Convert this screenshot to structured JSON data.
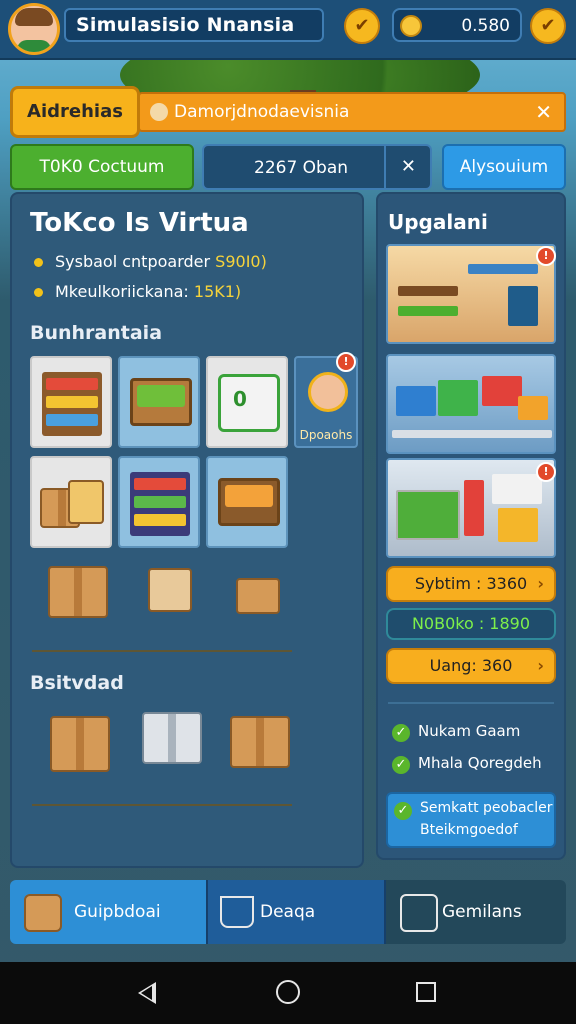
{
  "header": {
    "title": "Simulasisio Nnansia",
    "coin_value": "0.580",
    "left_coin_icon": "checkmark-coin-icon",
    "right_coin_icon": "checkmark-coin-icon"
  },
  "banner": {
    "tag": "Aidrehias",
    "message": "Damorjdnodaevisnia",
    "close": "✕"
  },
  "actions": {
    "green_button": "T0K0 Coctuum",
    "field_value": "2267 Oban",
    "field_clear": "✕",
    "blue_button": "Alysouium"
  },
  "store": {
    "title": "ToKco Is Virtua",
    "stats": [
      {
        "label": "Sysbaol cntpoarder ",
        "value": "S90I0)"
      },
      {
        "label": "Mkeulkoriickana: ",
        "value": "15K1)"
      }
    ],
    "section1": "Bunhrantaia",
    "worker_label": "Dpoaohs",
    "worker_badge": "!",
    "section2": "Bsitvdad"
  },
  "upgrades": {
    "title": "Upgalani",
    "badge": "!",
    "prices": [
      {
        "label": "Sybtim : 3360",
        "style": "orange"
      },
      {
        "label": "N0B0ko : 1890",
        "style": "teal"
      },
      {
        "label": "Uang: 360",
        "style": "orange"
      }
    ],
    "checks": [
      "Nukam Gaam",
      "Mhala Qoregdeh"
    ],
    "info_line1": "Semkatt peobacler",
    "info_line2": "Bteikmgoedof"
  },
  "nav": [
    {
      "label": "Guipbdoai",
      "icon": "box-icon"
    },
    {
      "label": "Deaqa",
      "icon": "cart-icon"
    },
    {
      "label": "Gemilans",
      "icon": "basket-icon"
    }
  ],
  "colors": {
    "accent_orange": "#f8ae1e",
    "accent_blue": "#2d9ae6",
    "accent_green": "#4caf2f",
    "panel": "#2f5a7a"
  }
}
